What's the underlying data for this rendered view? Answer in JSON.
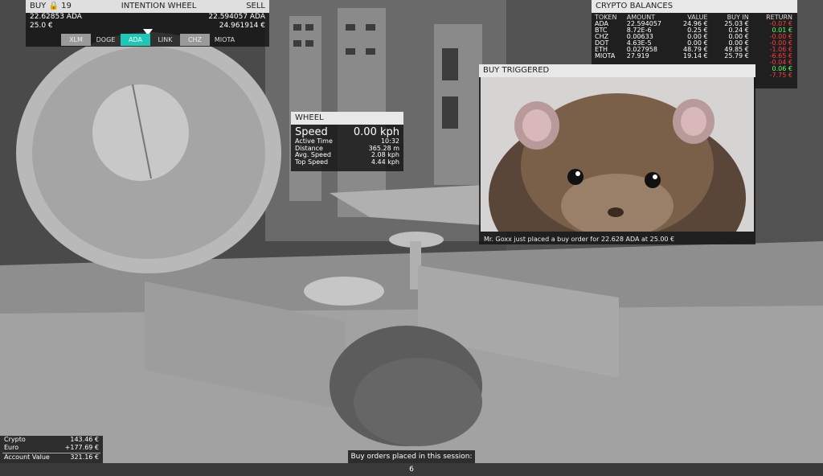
{
  "intention": {
    "buy_label": "BUY",
    "lock_count": "19",
    "title": "INTENTION WHEEL",
    "sell_label": "SELL",
    "left_amount": "22.62853 ADA",
    "left_price": "25.0 €",
    "right_amount": "22.594057 ADA",
    "right_value": "24.961914 €",
    "coins": [
      "XLM",
      "DOGE",
      "ADA",
      "LINK",
      "CHZ",
      "MIOTA"
    ],
    "selected_coin": "ADA"
  },
  "wheel": {
    "title": "WHEEL",
    "speed_label": "Speed",
    "speed_value": "0.00 kph",
    "stats": [
      {
        "label": "Active Time",
        "value": "10:32"
      },
      {
        "label": "Distance",
        "value": "365.28 m"
      },
      {
        "label": "Avg. Speed",
        "value": "2.08 kph"
      },
      {
        "label": "Top Speed",
        "value": "4.44 kph"
      }
    ]
  },
  "balances": {
    "title": "CRYPTO BALANCES",
    "headers": [
      "TOKEN",
      "AMOUNT",
      "VALUE",
      "BUY IN",
      "RETURN"
    ],
    "rows": [
      {
        "token": "ADA",
        "amount": "22.594057",
        "value": "24.96 €",
        "buyin": "25.03 €",
        "ret": "-0.07 €",
        "sign": "neg"
      },
      {
        "token": "BTC",
        "amount": "8.72E-6",
        "value": "0.25 €",
        "buyin": "0.24 €",
        "ret": "0.01 €",
        "sign": "pos"
      },
      {
        "token": "CHZ",
        "amount": "0.00633",
        "value": "0.00 €",
        "buyin": "0.00 €",
        "ret": "-0.00 €",
        "sign": "neg"
      },
      {
        "token": "DOT",
        "amount": "4.63E-5",
        "value": "0.00 €",
        "buyin": "0.00 €",
        "ret": "-0.00 €",
        "sign": "neg"
      },
      {
        "token": "ETH",
        "amount": "0.027958",
        "value": "48.79 €",
        "buyin": "49.85 €",
        "ret": "-1.06 €",
        "sign": "neg"
      },
      {
        "token": "MIOTA",
        "amount": "27.919",
        "value": "19.14 €",
        "buyin": "25.79 €",
        "ret": "-6.65 €",
        "sign": "neg"
      }
    ],
    "extra_returns": [
      {
        "ret": "-0.04 €",
        "sign": "neg"
      },
      {
        "ret": "0.06 €",
        "sign": "pos"
      },
      {
        "ret": "-7.75 €",
        "sign": "neg"
      }
    ]
  },
  "buy_triggered": {
    "title": "BUY TRIGGERED",
    "caption": "Mr. Goxx just placed a buy order for 22.628 ADA at 25.00 €"
  },
  "account": {
    "crypto_label": "Crypto",
    "crypto_value": "143.46 €",
    "euro_label": "Euro",
    "euro_value": "+177.69 €",
    "total_label": "Account Value",
    "total_value": "321.16 €"
  },
  "session": {
    "text": "Buy orders placed in this session: 6"
  }
}
